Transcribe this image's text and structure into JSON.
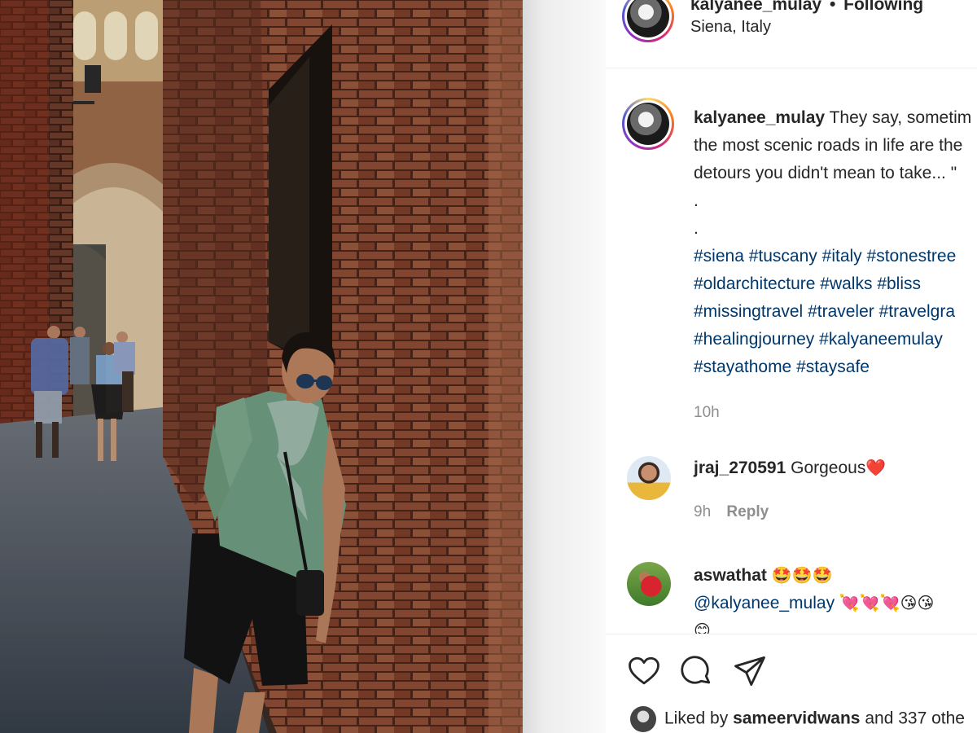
{
  "post": {
    "username": "kalyanee_mulay",
    "follow_status": "Following",
    "separator": "•",
    "location": "Siena, Italy"
  },
  "caption": {
    "username": "kalyanee_mulay",
    "lines": [
      "They say, sometim",
      "the most scenic roads in life are the",
      "detours you didn't mean to take... \"",
      ".",
      "."
    ],
    "hashtag_lines": [
      [
        "#siena",
        "#tuscany",
        "#italy",
        "#stonestree"
      ],
      [
        "#oldarchitecture",
        "#walks",
        "#bliss"
      ],
      [
        "#missingtravel",
        "#traveler",
        "#travelgra"
      ],
      [
        "#healingjourney",
        "#kalyaneemulay"
      ],
      [
        "#stayathome",
        "#staysafe"
      ]
    ],
    "time": "10h"
  },
  "comments": [
    {
      "username": "jraj_270591",
      "text": "Gorgeous",
      "emoji": "❤️",
      "time": "9h",
      "reply_label": "Reply"
    },
    {
      "username": "aswathat",
      "emoji_line1": "🤩🤩🤩",
      "mention": "@kalyanee_mulay",
      "emoji_line2": "💘💘💘😘😘",
      "emoji_line3": "😊"
    }
  ],
  "actions": {
    "icons": [
      "heart-icon",
      "comment-icon",
      "share-icon"
    ],
    "liked_prefix": "Liked by",
    "liked_user": "sameervidwans",
    "liked_suffix": "and 337 othe"
  },
  "colors": {
    "hashtag": "#00376b",
    "muted": "#8e8e8e",
    "text": "#262626",
    "ring": [
      "#feda75",
      "#fa7e1e",
      "#d62976",
      "#962fbf",
      "#4f5bd5"
    ]
  }
}
